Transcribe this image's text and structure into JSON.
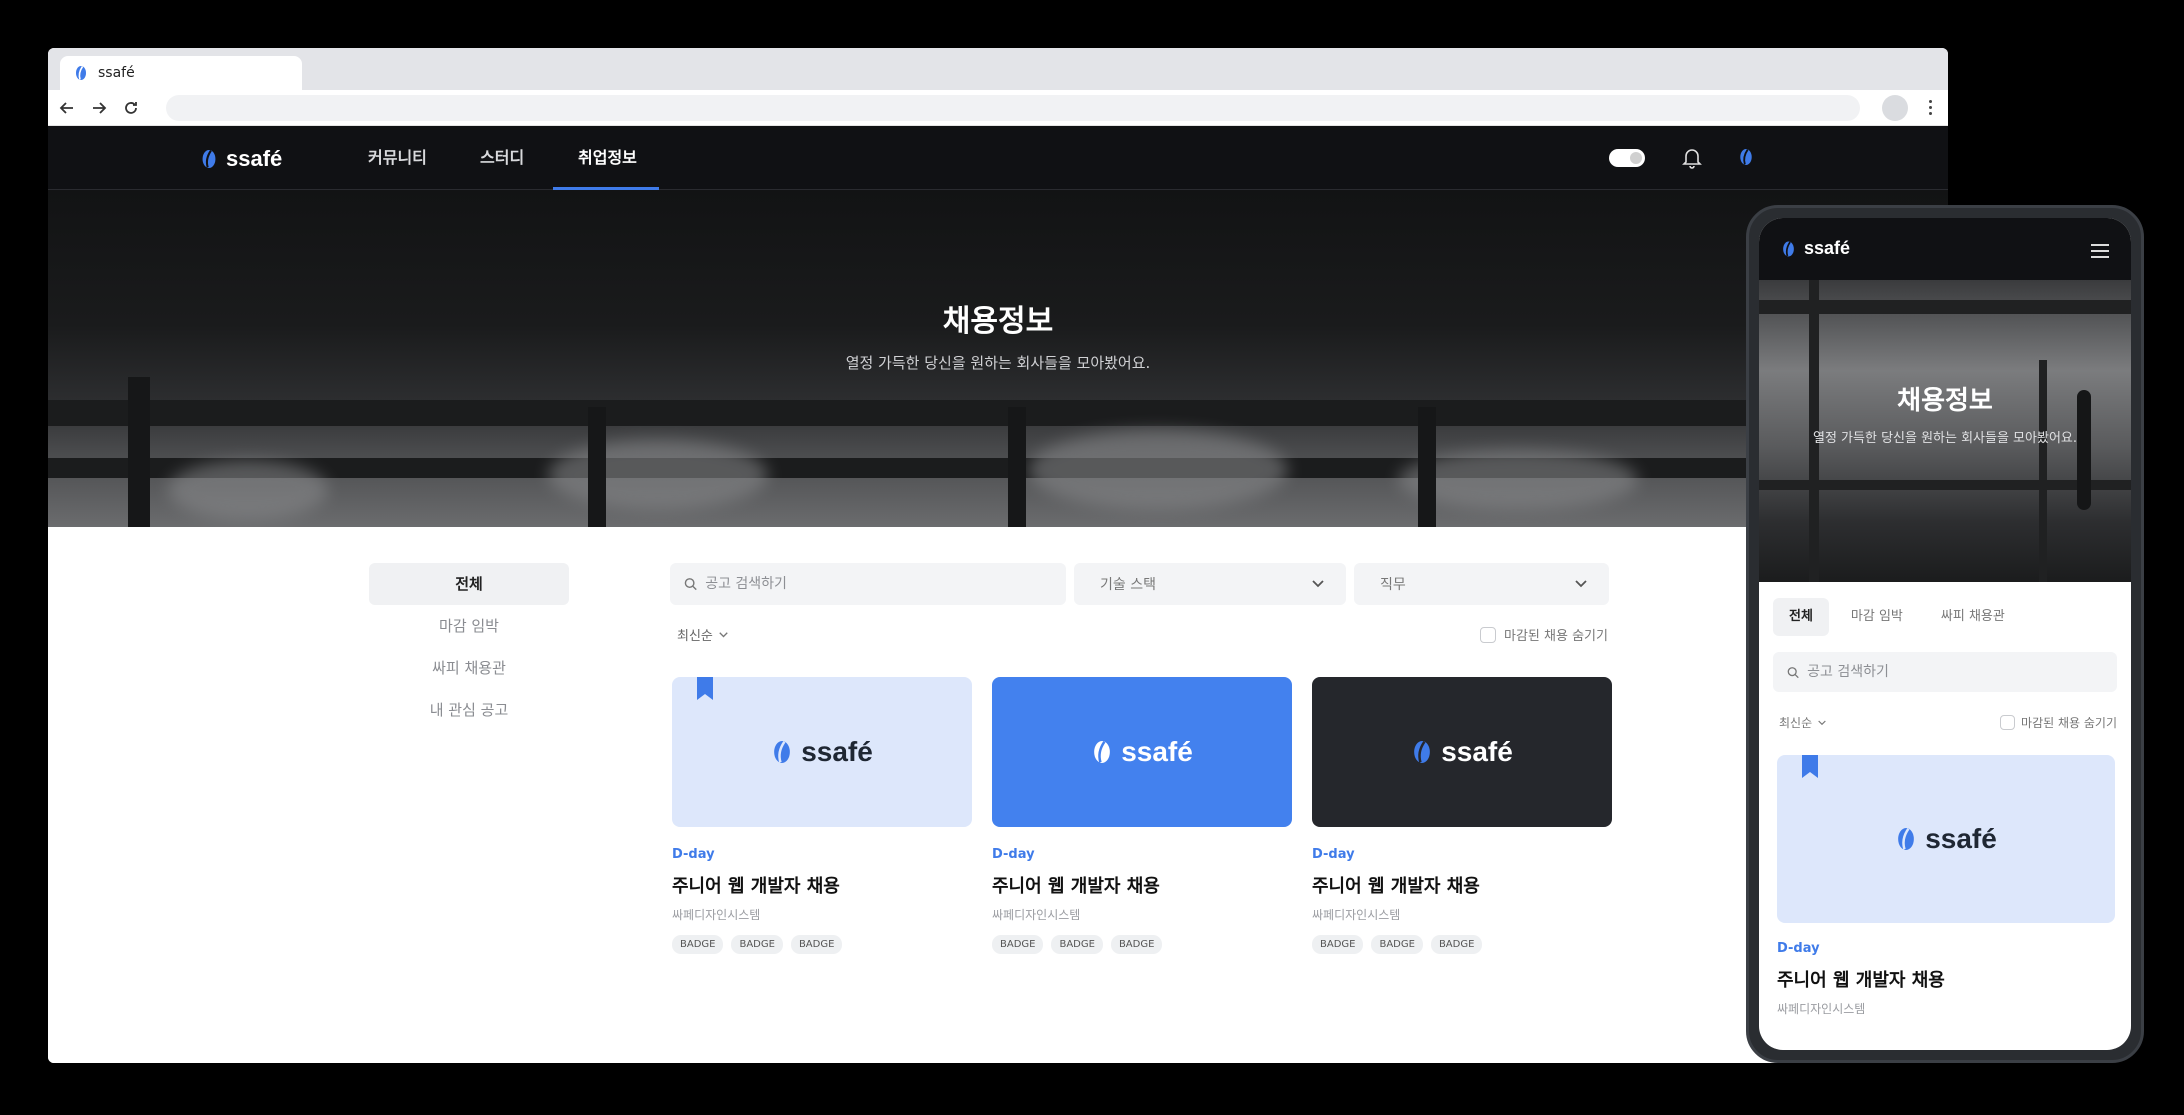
{
  "browser": {
    "tab_title": "ssafé"
  },
  "site": {
    "logo_text": "ssafé",
    "nav": [
      "커뮤니티",
      "스터디",
      "취업정보"
    ],
    "active_nav": "취업정보"
  },
  "hero": {
    "title": "채용정보",
    "subtitle": "열정 가득한 당신을 원하는 회사들을 모아봤어요."
  },
  "sidebar": {
    "items": [
      "전체",
      "마감 임박",
      "싸피 채용관",
      "내 관심 공고"
    ]
  },
  "filters": {
    "search_placeholder": "공고 검색하기",
    "tech_stack": "기술 스택",
    "job": "직무",
    "sort": "최신순",
    "hide_closed": "마감된 채용 숨기기"
  },
  "cards": [
    {
      "dday": "D-day",
      "title": "주니어 웹 개발자 채용",
      "company": "싸페디자인시스템",
      "badges": [
        "BADGE",
        "BADGE",
        "BADGE"
      ],
      "thumb_color": "#dde7fb",
      "logo_color": "#1f2733",
      "bookmarked": true
    },
    {
      "dday": "D-day",
      "title": "주니어 웹 개발자 채용",
      "company": "싸페디자인시스템",
      "badges": [
        "BADGE",
        "BADGE",
        "BADGE"
      ],
      "thumb_color": "#4381ee",
      "logo_color": "#ffffff",
      "bookmarked": false
    },
    {
      "dday": "D-day",
      "title": "주니어 웹 개발자 채용",
      "company": "싸페디자인시스템",
      "badges": [
        "BADGE",
        "BADGE",
        "BADGE"
      ],
      "thumb_color": "#25272c",
      "logo_color": "#ffffff",
      "bookmarked": false
    }
  ],
  "mobile": {
    "tabs": [
      "전체",
      "마감 임박",
      "싸피 채용관"
    ],
    "card": {
      "dday": "D-day",
      "title": "주니어 웹 개발자 채용",
      "company": "싸페디자인시스템"
    }
  },
  "colors": {
    "accent": "#3f7be9",
    "header_bg": "#101114"
  }
}
